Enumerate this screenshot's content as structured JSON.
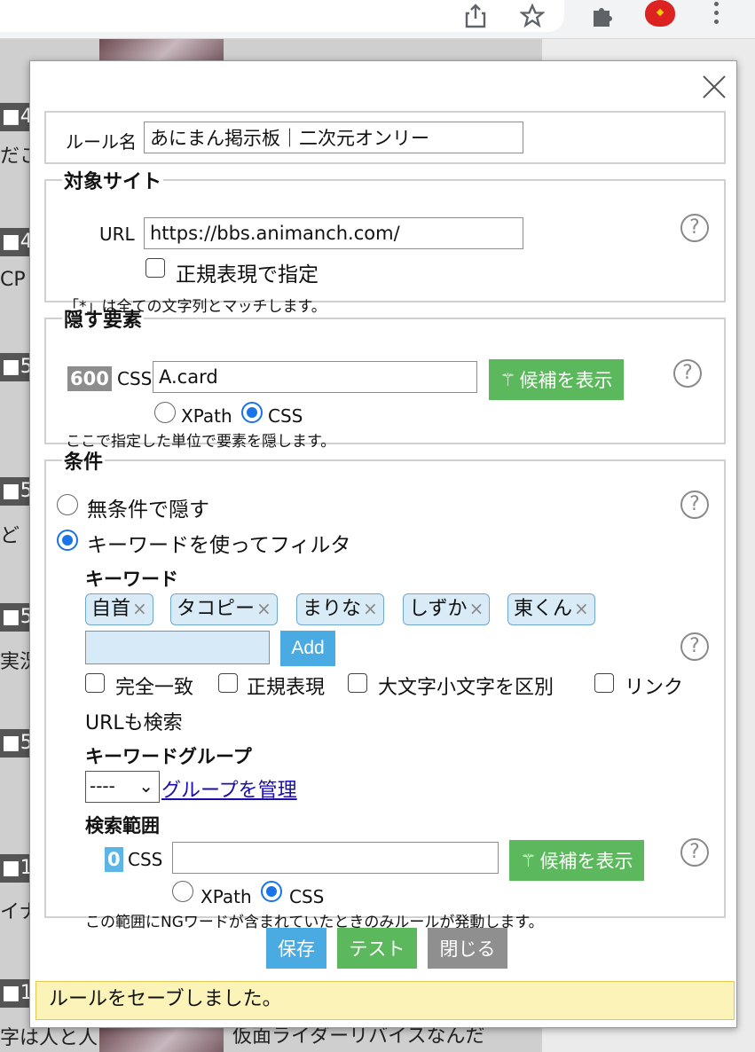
{
  "browser": {
    "icons": [
      "share-icon",
      "star-icon",
      "extensions-icon",
      "tomato-extension-icon",
      "menu-icon"
    ]
  },
  "background": {
    "strips": [
      "■4",
      "■4",
      "■5",
      "■5",
      "■5",
      "■5",
      "■1",
      "■1"
    ],
    "texts": [
      "だこ",
      "CP",
      "ど",
      "実況",
      "イナ",
      "字は人と人"
    ],
    "caption": "仮面ライダーリバイスなんだ"
  },
  "dialog": {
    "rule_name": {
      "label": "ルール名",
      "value": "あにまん掲示板｜二次元オンリー"
    },
    "target_site": {
      "legend": "対象サイト",
      "url_label": "URL",
      "url_value": "https://bbs.animanch.com/",
      "regex_label": "正規表現で指定",
      "note": "「*」は全ての文字列とマッチします。"
    },
    "hide_element": {
      "legend": "隠す要素",
      "count": "600",
      "type_label": "CSS",
      "selector_value": "A.card",
      "suggest_label": "候補を表示",
      "xpath_label": "XPath",
      "css_label": "CSS",
      "note": "ここで指定した単位で要素を隠します。"
    },
    "condition": {
      "legend": "条件",
      "unconditional_label": "無条件で隠す",
      "keyword_filter_label": "キーワードを使ってフィルタ",
      "keyword_heading": "キーワード",
      "keywords": [
        "自首",
        "タコピー",
        "まりな",
        "しずか",
        "東くん"
      ],
      "keyword_input_value": "",
      "add_label": "Add",
      "exact_label": "完全一致",
      "regex_label": "正規表現",
      "case_label": "大文字小文字を区別",
      "link_label": "リンク",
      "link_label_cont": "URLも検索",
      "group_heading": "キーワードグループ",
      "group_selected": "----",
      "manage_group_label": "グループを管理",
      "scope_heading": "検索範囲",
      "scope_count": "0",
      "scope_type_label": "CSS",
      "scope_value": "",
      "scope_suggest_label": "候補を表示",
      "scope_xpath_label": "XPath",
      "scope_css_label": "CSS",
      "scope_note": "この範囲にNGワードが含まれていたときのみルールが発動します。"
    },
    "buttons": {
      "save": "保存",
      "test": "テスト",
      "close": "閉じる"
    },
    "status_message": "ルールをセーブしました。"
  },
  "colors": {
    "green": "#5cb85c",
    "blue": "#4aabe3",
    "gray_button": "#8f8f8f",
    "status_bg": "#fcf3b8",
    "link": "#1a0dab"
  }
}
